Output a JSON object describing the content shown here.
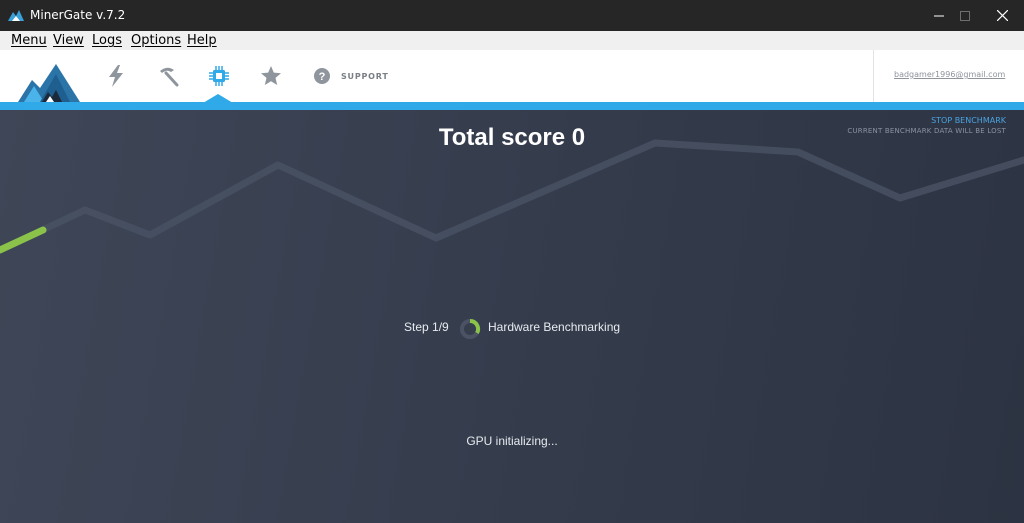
{
  "window": {
    "title": "MinerGate v.7.2",
    "icon": "minergate-logo-icon"
  },
  "menu": {
    "items": [
      {
        "label": "Menu"
      },
      {
        "label": "View"
      },
      {
        "label": "Logs"
      },
      {
        "label": "Options"
      },
      {
        "label": "Help"
      }
    ]
  },
  "toolbar": {
    "icons": [
      "lightning-icon",
      "pickaxe-icon",
      "chip-icon",
      "star-icon",
      "help-icon"
    ],
    "active_icon": "chip-icon",
    "support_label": "SUPPORT",
    "account_email": "badgamer1996@gmail.com"
  },
  "benchmark": {
    "total_score": "Total score 0",
    "stop_link": "STOP BENCHMARK",
    "stop_warning": "CURRENT BENCHMARK DATA WILL BE LOST",
    "step": "Step 1/9",
    "step_name": "Hardware Benchmarking",
    "status": "GPU initializing..."
  },
  "colors": {
    "accent": "#2fa9e8",
    "progress": "#8bc34a",
    "background": "#363e4e"
  }
}
